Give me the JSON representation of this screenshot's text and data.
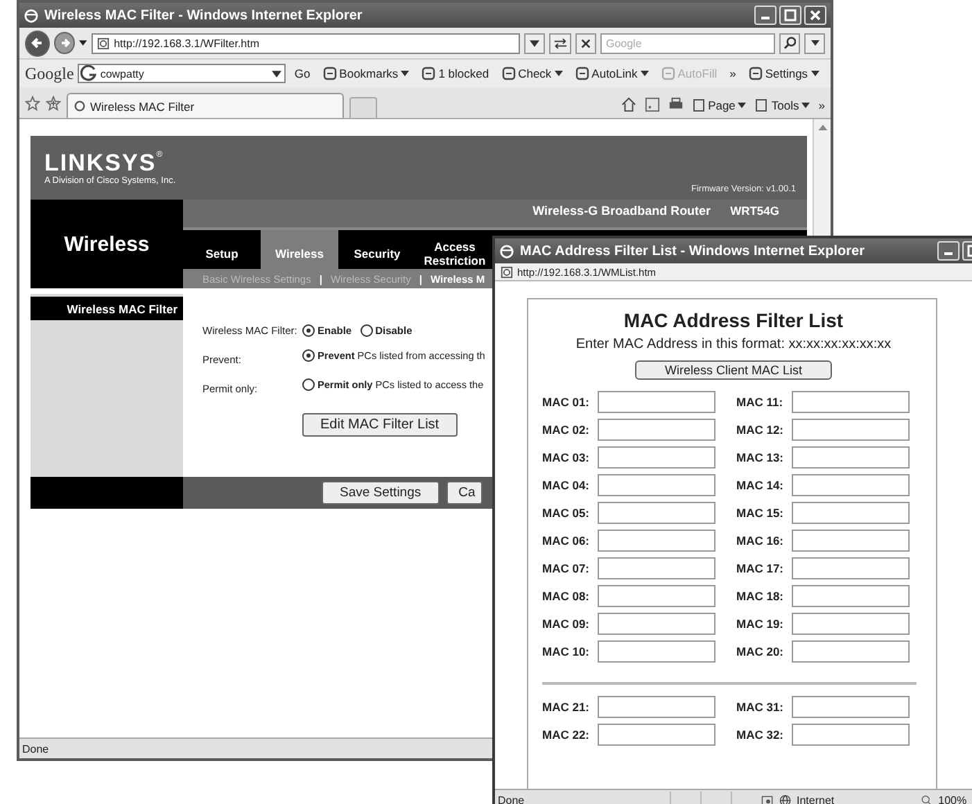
{
  "main_window": {
    "title": "Wireless MAC Filter - Windows Internet Explorer",
    "address": "http://192.168.3.1/WFilter.htm",
    "search_placeholder": "Google",
    "google_toolbar": {
      "logo": "Google",
      "query": "cowpatty",
      "items": [
        {
          "label": "Go",
          "kind": "text",
          "dropdown": false,
          "disabled": false
        },
        {
          "label": "Bookmarks",
          "kind": "icon",
          "dropdown": true,
          "disabled": false
        },
        {
          "label": "1 blocked",
          "kind": "icon",
          "dropdown": false,
          "disabled": false
        },
        {
          "label": "Check",
          "kind": "icon",
          "dropdown": true,
          "disabled": false
        },
        {
          "label": "AutoLink",
          "kind": "icon",
          "dropdown": true,
          "disabled": false
        },
        {
          "label": "AutoFill",
          "kind": "icon",
          "dropdown": false,
          "disabled": true
        },
        {
          "label": "»",
          "kind": "text",
          "dropdown": false,
          "disabled": false
        },
        {
          "label": "Settings",
          "kind": "icon",
          "dropdown": true,
          "disabled": false
        }
      ]
    },
    "tab": {
      "label": "Wireless MAC Filter"
    },
    "commands": [
      {
        "label": "Page"
      },
      {
        "label": "Tools"
      },
      {
        "label": "»"
      }
    ],
    "page": {
      "brand": "LINKSYS",
      "registered": "®",
      "division": "A Division of Cisco Systems, Inc.",
      "firmware": "Firmware Version: v1.00.1",
      "product": "Wireless-G Broadband Router",
      "model": "WRT54G",
      "section": "Wireless",
      "tabs": [
        {
          "label": "Setup",
          "selected": false
        },
        {
          "label": "Wireless",
          "selected": true
        },
        {
          "label": "Security",
          "selected": false
        },
        {
          "label": "Access\nRestriction",
          "selected": false
        }
      ],
      "separator": "|",
      "subtabs": [
        {
          "label": "Basic Wireless Settings",
          "selected": false
        },
        {
          "label": "Wireless Security",
          "selected": false
        },
        {
          "label": "Wireless M",
          "selected": true
        }
      ],
      "side_label": "Wireless MAC Filter",
      "filter": {
        "label": "Wireless MAC Filter:",
        "options": [
          {
            "label": "Enable",
            "selected": true
          },
          {
            "label": "Disable",
            "selected": false
          }
        ]
      },
      "modes": [
        {
          "label": "Prevent:",
          "option": "**Prevent** PCs listed from accessing th",
          "selected": true
        },
        {
          "label": "Permit only:",
          "option": "**Permit only** PCs listed to access the",
          "selected": false
        }
      ],
      "edit_button": "Edit MAC Filter List",
      "save_button": "Save Settings",
      "cancel_button": "Ca"
    },
    "status": "Done"
  },
  "popup_window": {
    "title": "MAC Address Filter List - Windows Internet Explorer",
    "address": "http://192.168.3.1/WMList.htm",
    "heading": "MAC Address Filter List",
    "format_hint": "Enter MAC Address in this format: xx:xx:xx:xx:xx:xx",
    "client_list_button": "Wireless Client MAC List",
    "groups": [
      {
        "left": [
          "MAC 01:",
          "MAC 02:",
          "MAC 03:",
          "MAC 04:",
          "MAC 05:",
          "MAC 06:",
          "MAC 07:",
          "MAC 08:",
          "MAC 09:",
          "MAC 10:"
        ],
        "right": [
          "MAC 11:",
          "MAC 12:",
          "MAC 13:",
          "MAC 14:",
          "MAC 15:",
          "MAC 16:",
          "MAC 17:",
          "MAC 18:",
          "MAC 19:",
          "MAC 20:"
        ]
      },
      {
        "left": [
          "MAC 21:",
          "MAC 22:"
        ],
        "right": [
          "MAC 31:",
          "MAC 32:"
        ]
      }
    ],
    "status": "Done",
    "zone": "Internet",
    "zoom": "100%"
  }
}
